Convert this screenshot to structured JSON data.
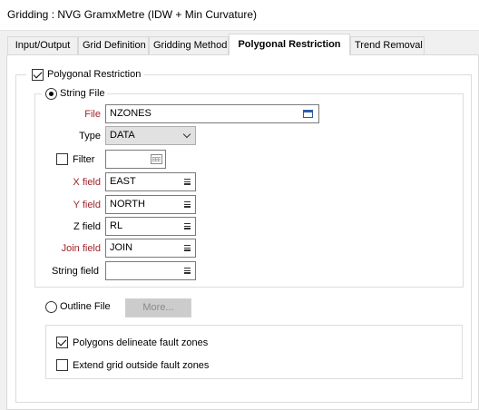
{
  "window": {
    "title": "Gridding : NVG GramxMetre (IDW + Min Curvature)"
  },
  "tabs": [
    {
      "label": "Input/Output"
    },
    {
      "label": "Grid Definition"
    },
    {
      "label": "Gridding Method"
    },
    {
      "label": "Polygonal Restriction",
      "active": true
    },
    {
      "label": "Trend Removal"
    }
  ],
  "polygonal_restriction": {
    "label": "Polygonal Restriction",
    "checked": true
  },
  "string_file": {
    "radio_label": "String File",
    "selected": true,
    "file": {
      "label": "File",
      "value": "NZONES"
    },
    "type": {
      "label": "Type",
      "value": "DATA"
    },
    "filter": {
      "label": "Filter",
      "checked": false,
      "value": ""
    },
    "x_field": {
      "label": "X field",
      "value": "EAST"
    },
    "y_field": {
      "label": "Y field",
      "value": "NORTH"
    },
    "z_field": {
      "label": "Z field",
      "value": "RL"
    },
    "join_field": {
      "label": "Join field",
      "value": "JOIN"
    },
    "string_field": {
      "label": "String field",
      "value": ""
    }
  },
  "outline_file": {
    "radio_label": "Outline File",
    "selected": false,
    "more_label": "More..."
  },
  "options": {
    "polygons_delineate": {
      "label": "Polygons delineate fault zones",
      "checked": true
    },
    "extend_grid": {
      "label": "Extend grid outside fault zones",
      "checked": false
    }
  },
  "colors": {
    "required_label": "#a0252a",
    "border": "#d9d9d9",
    "accent": "#2b5ea8"
  }
}
